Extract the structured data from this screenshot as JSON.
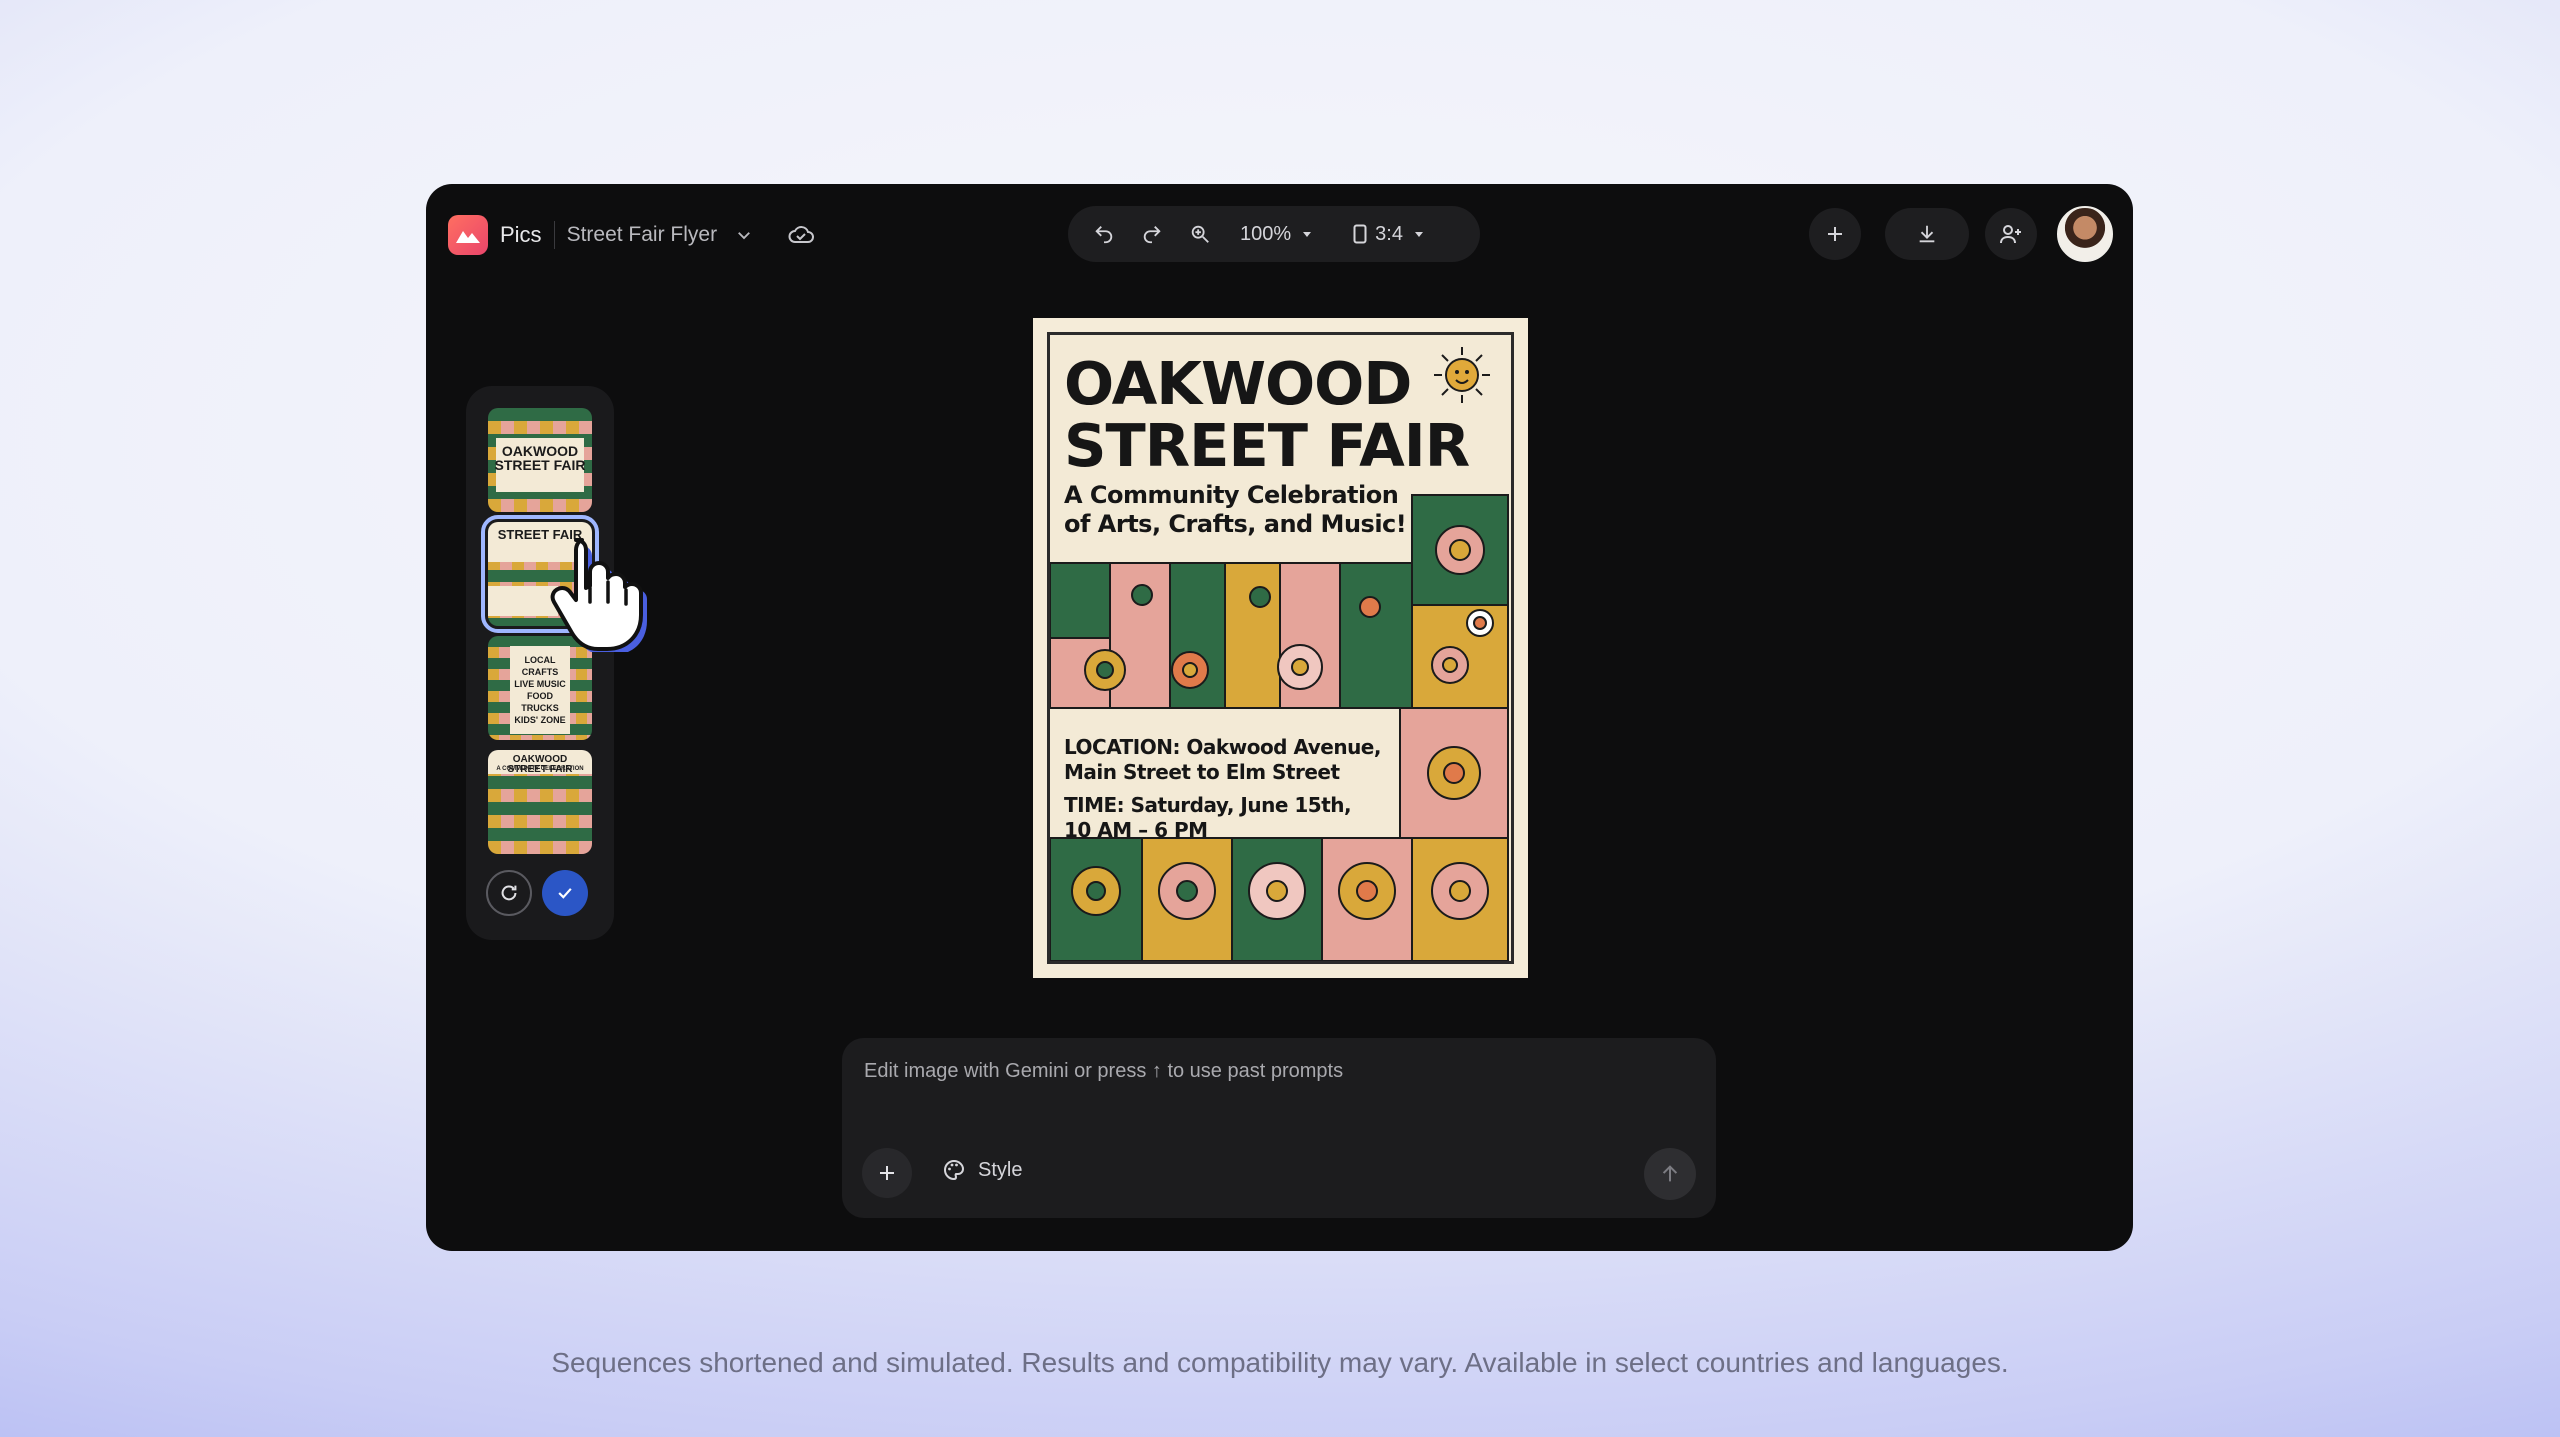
{
  "app": {
    "name": "Pics",
    "document_title": "Street Fair Flyer"
  },
  "toolbar": {
    "zoom_level": "100%",
    "aspect_ratio": "3:4"
  },
  "thumbnails": [
    {
      "title": "OAKWOOD STREET FAIR"
    },
    {
      "title": "STREET FAIR"
    },
    {
      "title": "LOCAL CRAFTS LIVE MUSIC FOOD TRUCKS KIDS' ZONE"
    },
    {
      "title": "OAKWOOD STREET FAIR",
      "sub": "A COMMUNITY CELEBRATION"
    }
  ],
  "poster": {
    "title_line1": "OAKWOOD",
    "title_line2": "STREET FAIR",
    "subtitle_line1": "A Community Celebration",
    "subtitle_line2": "of Arts, Crafts, and Music!",
    "location_line1": "LOCATION: Oakwood Avenue,",
    "location_line2": "Main Street to Elm Street",
    "time_line1": "TIME: Saturday, June 15th,",
    "time_line2": "10 AM – 6 PM"
  },
  "prompt": {
    "placeholder": "Edit image with Gemini or press ↑ to use past prompts",
    "style_label": "Style"
  },
  "disclaimer": "Sequences shortened and simulated. Results and compatibility may vary. Available in select countries and languages.",
  "colors": {
    "green": "#2f6b45",
    "pink": "#e5a49a",
    "mustard": "#d9a83a",
    "cream": "#f3ead6",
    "accent_blue": "#2b56c6"
  }
}
